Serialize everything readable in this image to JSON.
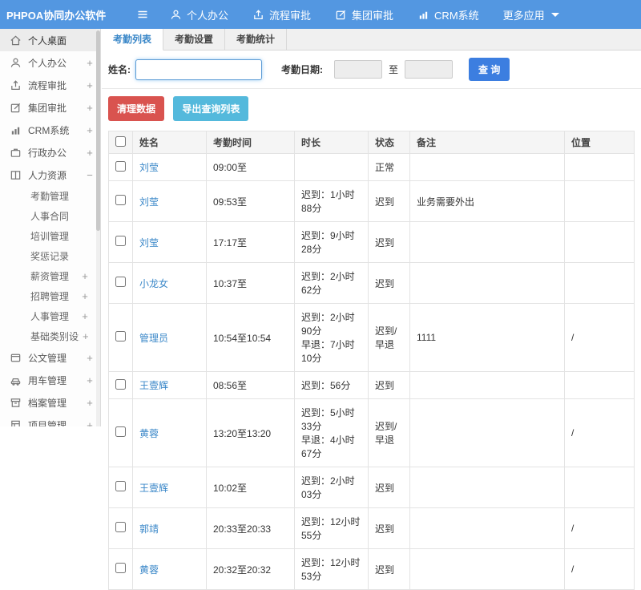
{
  "colors": {
    "header_blue": "#5397e1",
    "link_blue": "#3a87c8",
    "late_red": "#dc2420",
    "danger_btn": "#d9534f",
    "info_btn": "#54b9dc",
    "search_btn": "#3c7ee0"
  },
  "header": {
    "logo": "PHPOA协同办公软件",
    "nav": [
      {
        "label": "个人办公"
      },
      {
        "label": "流程审批"
      },
      {
        "label": "集团审批"
      },
      {
        "label": "CRM系统"
      },
      {
        "label": "更多应用"
      }
    ]
  },
  "sidebar": {
    "items": [
      {
        "label": "个人桌面",
        "expander": ""
      },
      {
        "label": "个人办公",
        "expander": "+"
      },
      {
        "label": "流程审批",
        "expander": "+"
      },
      {
        "label": "集团审批",
        "expander": "+"
      },
      {
        "label": "CRM系统",
        "expander": "+"
      },
      {
        "label": "行政办公",
        "expander": "+"
      },
      {
        "label": "人力资源",
        "expander": "−"
      },
      {
        "label": "公文管理",
        "expander": "+"
      },
      {
        "label": "用车管理",
        "expander": "+"
      },
      {
        "label": "档案管理",
        "expander": "+"
      },
      {
        "label": "项目管理",
        "expander": "+"
      }
    ],
    "hr_children": [
      {
        "label": "考勤管理",
        "expander": ""
      },
      {
        "label": "人事合同",
        "expander": ""
      },
      {
        "label": "培训管理",
        "expander": ""
      },
      {
        "label": "奖惩记录",
        "expander": ""
      },
      {
        "label": "薪资管理",
        "expander": "+"
      },
      {
        "label": "招聘管理",
        "expander": "+"
      },
      {
        "label": "人事管理",
        "expander": "+"
      },
      {
        "label": "基础类别设置",
        "expander": "+"
      }
    ]
  },
  "tabs": [
    {
      "label": "考勤列表",
      "active": true
    },
    {
      "label": "考勤设置",
      "active": false
    },
    {
      "label": "考勤统计",
      "active": false
    }
  ],
  "filter": {
    "name_label": "姓名:",
    "name_value": "",
    "date_label": "考勤日期:",
    "date_from": "",
    "to_label": "至",
    "date_to": "",
    "search_button": "查 询"
  },
  "actions": {
    "clean_button": "清理数据",
    "export_button": "导出查询列表"
  },
  "table": {
    "columns": [
      "姓名",
      "考勤时间",
      "时长",
      "状态",
      "备注",
      "位置"
    ],
    "rows": [
      {
        "name": "刘莹",
        "time": "09:00至",
        "duration1": "",
        "duration2": "",
        "status": "正常",
        "remark": "",
        "location": ""
      },
      {
        "name": "刘莹",
        "time": "09:53至",
        "duration1": "迟到：1小时88分",
        "duration2": "",
        "status": "迟到",
        "remark": "业务需要外出",
        "location": ""
      },
      {
        "name": "刘莹",
        "time": "17:17至",
        "duration1": "迟到：9小时28分",
        "duration2": "",
        "status": "迟到",
        "remark": "",
        "location": ""
      },
      {
        "name": "小龙女",
        "time": "10:37至",
        "duration1": "迟到：2小时62分",
        "duration2": "",
        "status": "迟到",
        "remark": "",
        "location": ""
      },
      {
        "name": "管理员",
        "time": "10:54至10:54",
        "duration1": "迟到：2小时90分",
        "duration2": "早退：7小时10分",
        "status": "迟到/早退",
        "remark": "1111",
        "location": "/"
      },
      {
        "name": "王壹辉",
        "time": "08:56至",
        "duration1": "迟到：56分",
        "duration2": "",
        "status": "迟到",
        "remark": "",
        "location": ""
      },
      {
        "name": "黄蓉",
        "time": "13:20至13:20",
        "duration1": "迟到：5小时33分",
        "duration2": "早退：4小时67分",
        "status": "迟到/早退",
        "remark": "",
        "location": "/"
      },
      {
        "name": "王壹辉",
        "time": "10:02至",
        "duration1": "迟到：2小时03分",
        "duration2": "",
        "status": "迟到",
        "remark": "",
        "location": ""
      },
      {
        "name": "郭靖",
        "time": "20:33至20:33",
        "duration1": "迟到：12小时55分",
        "duration2": "",
        "status": "迟到",
        "remark": "",
        "location": "/"
      },
      {
        "name": "黄蓉",
        "time": "20:32至20:32",
        "duration1": "迟到：12小时53分",
        "duration2": "",
        "status": "迟到",
        "remark": "",
        "location": "/"
      }
    ]
  }
}
